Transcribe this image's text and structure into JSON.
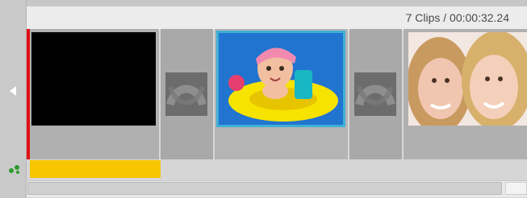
{
  "header": {
    "info": "7 Clips / 00:00:32.24"
  },
  "icons": {
    "fx": "magic-wand-icon",
    "adjust": "sliders-icon",
    "text": "T",
    "mute": "speaker-mute-icon",
    "transition": "film-reel-icon",
    "scroll_left": "triangle-left-icon",
    "audio": "audio-wave-icon"
  },
  "colors": {
    "active_toolbar": "#1f3f7a",
    "selected_border": "#3fb0d6",
    "playhead": "#e10f14",
    "track_yellow": "#f7c600"
  },
  "clips": [
    {
      "name": "clip-1",
      "thumbnail": "black frame",
      "active": [
        "fx",
        "text"
      ]
    },
    {
      "name": "clip-2",
      "thumbnail": "baby in yellow float",
      "selected": true,
      "active": []
    },
    {
      "name": "clip-3",
      "thumbnail": "two smiling women",
      "active": [
        "text"
      ]
    }
  ]
}
